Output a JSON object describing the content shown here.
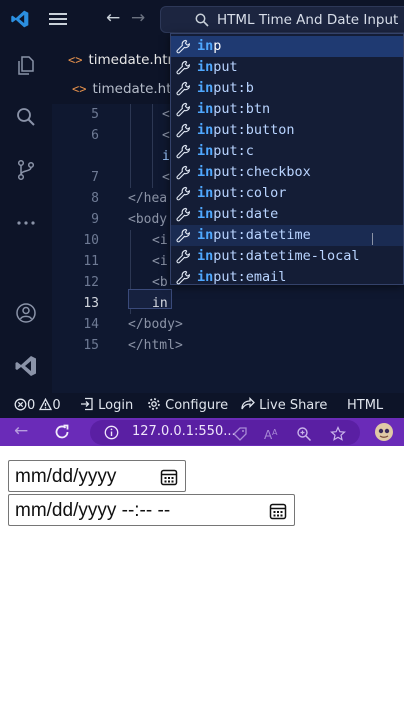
{
  "titlebar": {
    "command_center": "HTML Time And Date Input"
  },
  "tabs": [
    {
      "label": "timedate.htm"
    },
    {
      "label": "timedate.htm"
    }
  ],
  "editor": {
    "lines": [
      {
        "num": "5",
        "text": "<"
      },
      {
        "num": "6",
        "text": "<"
      },
      {
        "num": "",
        "text": "i"
      },
      {
        "num": "7",
        "text": "<"
      },
      {
        "num": "8",
        "text": "</hea"
      },
      {
        "num": "9",
        "text": "<body"
      },
      {
        "num": "10",
        "text": "<i"
      },
      {
        "num": "11",
        "text": "<i"
      },
      {
        "num": "12",
        "text": "<b"
      },
      {
        "num": "13",
        "text": "in"
      },
      {
        "num": "14",
        "text": "</body>"
      },
      {
        "num": "15",
        "text": "</html>"
      }
    ]
  },
  "suggestions": [
    {
      "match": "in",
      "rest": "p"
    },
    {
      "match": "in",
      "rest": "put"
    },
    {
      "match": "in",
      "rest": "put:b"
    },
    {
      "match": "in",
      "rest": "put:btn"
    },
    {
      "match": "in",
      "rest": "put:button"
    },
    {
      "match": "in",
      "rest": "put:c"
    },
    {
      "match": "in",
      "rest": "put:checkbox"
    },
    {
      "match": "in",
      "rest": "put:color"
    },
    {
      "match": "in",
      "rest": "put:date"
    },
    {
      "match": "in",
      "rest": "put:datetime"
    },
    {
      "match": "in",
      "rest": "put:datetime-local"
    },
    {
      "match": "in",
      "rest": "put:email"
    }
  ],
  "statusbar": {
    "errors": "0",
    "warnings": "0",
    "login": "Login",
    "configure": "Configure",
    "live_share": "Live Share",
    "language": "HTML"
  },
  "browser": {
    "url": "127.0.0.1:550..."
  },
  "page": {
    "date_input_value": "mm/dd/yyyy",
    "datetime_input_value": "mm/dd/yyyy --:-- --"
  },
  "colors": {
    "editor_bg": "#0f1830",
    "suggest_match": "#4fa8ff",
    "browser_bar": "#6a2bb8"
  }
}
